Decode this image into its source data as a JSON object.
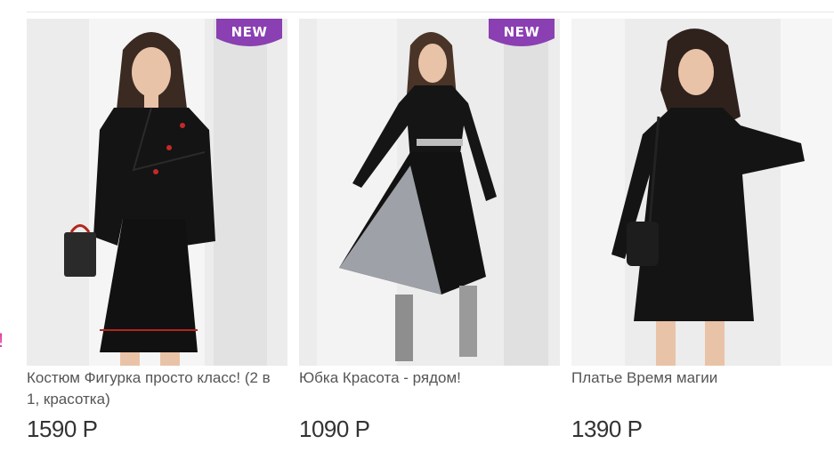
{
  "page": {
    "edge_text": "!"
  },
  "badge_text": "NEW",
  "colors": {
    "badge": "#8a3fb2",
    "accent_pink": "#e53fa3"
  },
  "products": [
    {
      "name": "Костюм Фигурка просто класс! (2 в 1, красотка)",
      "price": "1590 Р",
      "badge": true
    },
    {
      "name": "Юбка Красота - рядом!",
      "price": "1090 Р",
      "badge": true
    },
    {
      "name": "Платье Время магии",
      "price": "1390 Р",
      "badge": false
    }
  ]
}
